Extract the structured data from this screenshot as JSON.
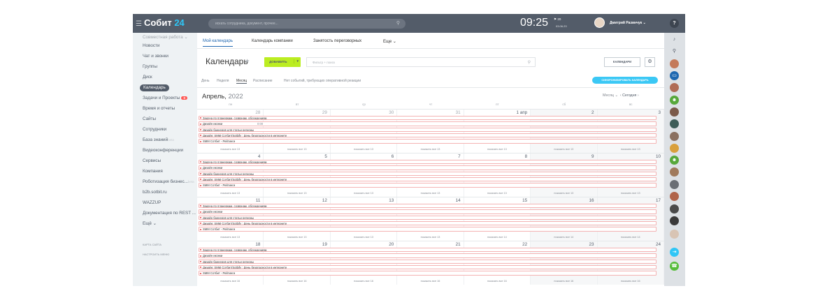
{
  "header": {
    "app_name": "Собит",
    "app_number": "24",
    "search_placeholder": "искать сотрудника, документ, прочее...",
    "time": "09:25",
    "flag_count": "20",
    "date": "03.06.23",
    "user_name": "Дмитрий Разинчук",
    "help": "?"
  },
  "sidebar": {
    "items": [
      {
        "label": "Совместная работа ⌄",
        "muted": true
      },
      {
        "label": "Новости"
      },
      {
        "label": "Чат и звонки"
      },
      {
        "label": "Группы"
      },
      {
        "label": "Диск"
      },
      {
        "label": "Календарь",
        "active": true
      },
      {
        "label": "Задачи и Проекты",
        "badge": "0"
      },
      {
        "label": "Время и отчеты"
      },
      {
        "label": "Сайты"
      },
      {
        "label": "Сотрудники"
      },
      {
        "label": "База знаний",
        "star": "beta"
      },
      {
        "label": "Видеоконференции"
      },
      {
        "label": "Сервисы"
      },
      {
        "label": "Компания"
      },
      {
        "label": "Роботизация бизнес...",
        "star": "beta"
      },
      {
        "label": "b2b.sotbit.ru"
      },
      {
        "label": "WAZZUP"
      },
      {
        "label": "Документация по REST ..."
      },
      {
        "label": "Ещё ⌄"
      }
    ],
    "sitemap": "КАРТА САЙТА",
    "configure": "НАСТРОИТЬ МЕНЮ"
  },
  "tabs": [
    "Мой календарь",
    "Календарь компании",
    "Занятость переговорных",
    "Еще ⌄"
  ],
  "toolbar": {
    "title": "Календарь",
    "add": "ДОБАВИТЬ",
    "filter_placeholder": "Фильтр + поиск",
    "calendars": "КАЛЕНДАРИ",
    "gear": "⚙"
  },
  "views": [
    "День",
    "Неделя",
    "Месяц",
    "Расписание",
    "Нет событий, требующих оперативной реакции"
  ],
  "sync": "СИНХРОНИЗИРОВАТЬ КАЛЕНДАРЬ",
  "month": {
    "name": "Апрель,",
    "year": "2022",
    "nav_month": "Месяц",
    "today": "Сегодня"
  },
  "daynames": [
    "пн",
    "вт",
    "ср",
    "чт",
    "пт",
    "сб",
    "вс"
  ],
  "weeks": [
    {
      "days": [
        "28",
        "29",
        "30",
        "31",
        "1 апр",
        "2",
        "3"
      ],
      "more": [
        "показать все 13",
        "показать все 13",
        "показать все 13",
        "показать все 13",
        "показать все 13",
        "показать все 13",
        "показать все 13"
      ]
    },
    {
      "days": [
        "4",
        "5",
        "6",
        "7",
        "8",
        "9",
        "10"
      ],
      "more": [
        "показать все 13",
        "показать все 13",
        "показать все 13",
        "показать все 13",
        "показать все 13",
        "показать все 13",
        "показать все 13"
      ]
    },
    {
      "days": [
        "11",
        "12",
        "13",
        "14",
        "15",
        "16",
        "17"
      ],
      "more": [
        "показать все 13",
        "показать все 13",
        "показать все 13",
        "показать все 13",
        "показать все 14",
        "показать все 14",
        "показать все 14"
      ]
    },
    {
      "days": [
        "18",
        "19",
        "20",
        "21",
        "22",
        "23",
        "24"
      ],
      "more": [
        "показать все 16",
        "показать все 16",
        "показать все 16",
        "показать все 16",
        "показать все 16",
        "показать все 16",
        "показать все 16"
      ]
    }
  ],
  "events": [
    {
      "title": "Задача по планеркам, созвонам, обсуждениям"
    },
    {
      "title": "Дизайн иконки",
      "time": "0:00"
    },
    {
      "title": "Дизайн баннеров для статьи регионы"
    },
    {
      "title": "Дизайн: SMM Сотбит/Sotbify : День безопасности в интернете"
    },
    {
      "title": "SMM Сотбит - Рейтинги"
    }
  ],
  "colors": {
    "topbar": "#535c69",
    "accent_blue": "#2067b0",
    "add_button": "#bbed21",
    "sync_button": "#3bc8f5",
    "event_border": "#f4b3b3"
  },
  "right_icons": [
    "bell-icon",
    "search-icon",
    "avatar",
    "chat-icon",
    "avatar",
    "group-icon",
    "avatar",
    "avatar",
    "avatar",
    "avatar",
    "group-icon",
    "avatar",
    "avatar",
    "avatar",
    "avatar",
    "avatar",
    "avatar",
    "exit-icon",
    "phone-icon"
  ]
}
